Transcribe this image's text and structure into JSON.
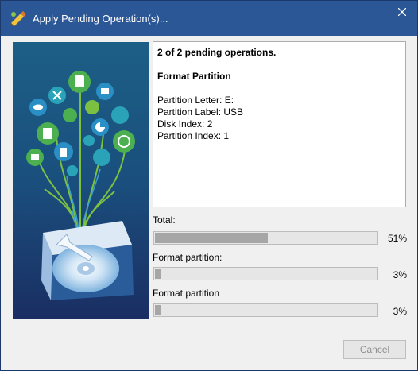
{
  "window": {
    "title": "Apply Pending Operation(s)...",
    "close_icon": "close-icon"
  },
  "details": {
    "summary": "2 of 2 pending operations.",
    "operation": "Format Partition",
    "fields": [
      "Partition Letter: E:",
      "Partition Label: USB",
      "Disk Index: 2",
      "Partition Index: 1"
    ]
  },
  "progress": [
    {
      "label": "Total:",
      "value": 51,
      "percent_text": "51%"
    },
    {
      "label": "Format partition:",
      "value": 3,
      "percent_text": "3%"
    },
    {
      "label": "Format partition",
      "value": 3,
      "percent_text": "3%"
    }
  ],
  "buttons": {
    "cancel": "Cancel"
  },
  "colors": {
    "titlebar": "#2b5797",
    "bar_fill": "#a6a6a6",
    "accent_green": "#4caf50",
    "accent_blue": "#2a8fc4"
  }
}
